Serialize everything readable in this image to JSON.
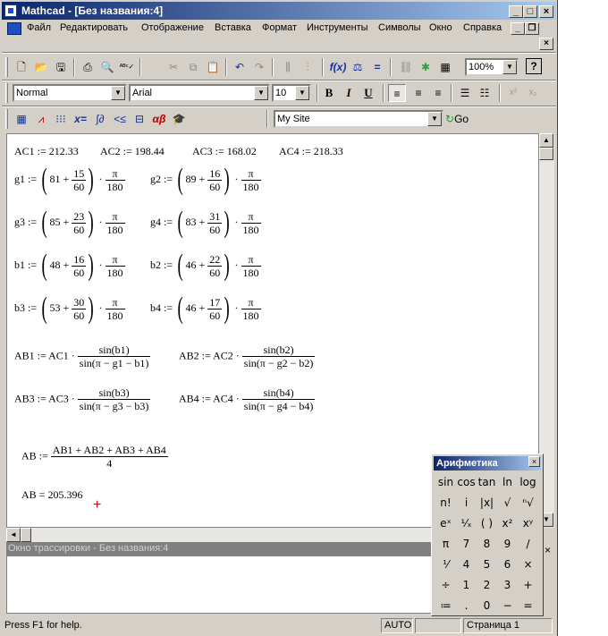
{
  "title": "Mathcad - [Без названия:4]",
  "menu": [
    "Файл",
    "Редактировать",
    "Отображение",
    "Вставка",
    "Формат",
    "Инструменты",
    "Символы",
    "Окно",
    "Справка"
  ],
  "toolbar": {
    "zoom": "100%",
    "style": "Normal",
    "font": "Arial",
    "size": "10",
    "site": "My Site",
    "go": "Go",
    "bold": "B",
    "italic": "I",
    "underline": "U"
  },
  "worksheet": {
    "ac": [
      "AC1 := 212.33",
      "AC2 := 198.44",
      "AC3 := 168.02",
      "AC4 := 218.33"
    ],
    "angles": [
      {
        "lhs": "g1 :=",
        "a": "81 +",
        "num": "15",
        "den": "60",
        "pi": "π",
        "k": "180"
      },
      {
        "lhs": "g2 :=",
        "a": "89 +",
        "num": "16",
        "den": "60",
        "pi": "π",
        "k": "180"
      },
      {
        "lhs": "g3 :=",
        "a": "85 +",
        "num": "23",
        "den": "60",
        "pi": "π",
        "k": "180"
      },
      {
        "lhs": "g4 :=",
        "a": "83 +",
        "num": "31",
        "den": "60",
        "pi": "π",
        "k": "180"
      },
      {
        "lhs": "b1 :=",
        "a": "48 +",
        "num": "16",
        "den": "60",
        "pi": "π",
        "k": "180"
      },
      {
        "lhs": "b2 :=",
        "a": "46 +",
        "num": "22",
        "den": "60",
        "pi": "π",
        "k": "180"
      },
      {
        "lhs": "b3 :=",
        "a": "53 +",
        "num": "30",
        "den": "60",
        "pi": "π",
        "k": "180"
      },
      {
        "lhs": "b4 :=",
        "a": "46 +",
        "num": "17",
        "den": "60",
        "pi": "π",
        "k": "180"
      }
    ],
    "ab": [
      {
        "lhs": "AB1 := AC1 ·",
        "num": "sin(b1)",
        "den": "sin(π − g1 − b1)"
      },
      {
        "lhs": "AB2 := AC2 ·",
        "num": "sin(b2)",
        "den": "sin(π − g2 − b2)"
      },
      {
        "lhs": "AB3 := AC3 ·",
        "num": "sin(b3)",
        "den": "sin(π − g3 − b3)"
      },
      {
        "lhs": "AB4 := AC4 ·",
        "num": "sin(b4)",
        "den": "sin(π − g4 − b4)"
      }
    ],
    "avg": {
      "lhs": "AB :=",
      "num": "AB1 + AB2 + AB3 + AB4",
      "den": "4"
    },
    "result": "AB = 205.396"
  },
  "trace_title": "Окно трассировки - Без названия:4",
  "status": {
    "help": "Press F1 for help.",
    "mode": "AUTO",
    "page": "Страница 1"
  },
  "palette": {
    "title": "Арифметика",
    "keys": [
      "sin",
      "cos",
      "tan",
      "ln",
      "log",
      "n!",
      "i",
      "|x|",
      "√",
      "ⁿ√",
      "eˣ",
      "¹⁄ₓ",
      "( )",
      "x²",
      "xʸ",
      "π",
      "7",
      "8",
      "9",
      "/",
      "⅟",
      "4",
      "5",
      "6",
      "×",
      "÷",
      "1",
      "2",
      "3",
      "+",
      "≔",
      ".",
      "0",
      "−",
      "="
    ]
  }
}
